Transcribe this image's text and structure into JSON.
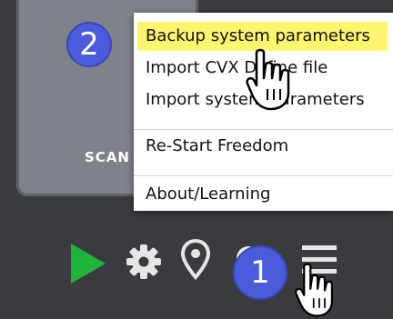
{
  "panel": {
    "label": "SCAN"
  },
  "menu": {
    "items": [
      {
        "label": "Backup system parameters",
        "highlighted": true
      },
      {
        "label": "Import CVX Define file",
        "highlighted": false
      },
      {
        "label": "Import system parameters",
        "highlighted": false
      },
      {
        "label": "Re-Start Freedom",
        "highlighted": false
      },
      {
        "label": "About/Learning",
        "highlighted": false
      }
    ]
  },
  "badges": {
    "step1": "1",
    "step2": "2"
  },
  "toolbar": {
    "icons": [
      "play-icon",
      "gear-icon",
      "location-pin-icon",
      "record-icon",
      "menu-icon"
    ]
  },
  "colors": {
    "highlight": "#fff56e",
    "badge": "#4a5bdc",
    "play": "#1fb53a",
    "toolbar_icon": "#e6e6e6",
    "background": "#3a3b3e"
  }
}
